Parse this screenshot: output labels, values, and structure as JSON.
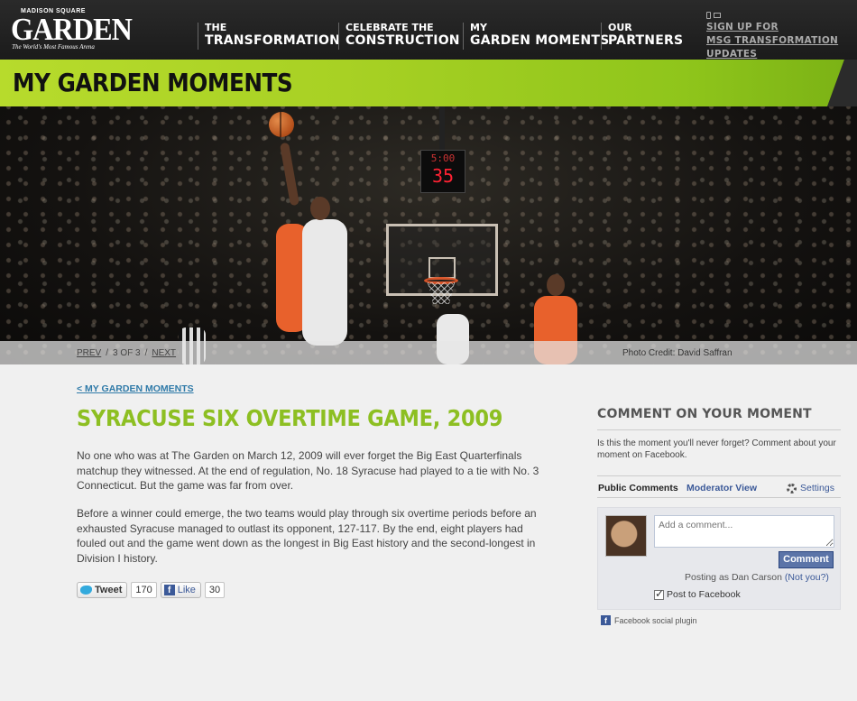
{
  "brand": {
    "logo_top": "MADISON SQUARE",
    "logo_main": "GARDEN",
    "logo_tagline": "The World's Most Famous Arena"
  },
  "nav": [
    {
      "line1": "THE",
      "line2": "TRANSFORMATION"
    },
    {
      "line1": "CELEBRATE THE",
      "line2": "CONSTRUCTION"
    },
    {
      "line1": "MY",
      "line2": "GARDEN MOMENTS"
    },
    {
      "line1": "OUR",
      "line2": "PARTNERS"
    }
  ],
  "signup": {
    "line1": "SIGN UP FOR",
    "line2": "MSG TRANSFORMATION UPDATES"
  },
  "banner": {
    "title": "MY GARDEN MOMENTS"
  },
  "hero": {
    "shot_clock_time": "5:00",
    "shot_clock_seconds": "35",
    "prev": "PREV",
    "position": "3 OF 3",
    "next": "NEXT",
    "separator": "/",
    "credit": "Photo Credit: David Saffran"
  },
  "article": {
    "back_link": "< MY GARDEN MOMENTS",
    "title": "SYRACUSE SIX OVERTIME GAME, 2009",
    "paragraph1": "No one who was at The Garden on March 12, 2009 will ever forget the Big East Quarterfinals matchup they witnessed. At the end of regulation, No. 18 Syracuse had played to a tie with No. 3 Connecticut. But the game was far from over.",
    "paragraph2": "Before a winner could emerge, the two teams would play through six overtime periods before an exhausted Syracuse managed to outlast its opponent, 127-117. By the end, eight players had fouled out and the game went down as the longest in Big East history and the second-longest in Division I history."
  },
  "social": {
    "tweet_label": "Tweet",
    "tweet_count": "170",
    "like_label": "Like",
    "like_count": "30"
  },
  "sidebar": {
    "heading": "COMMENT ON YOUR MOMENT",
    "intro": "Is this the moment you'll never forget? Comment about your moment on Facebook."
  },
  "fb": {
    "tab_public": "Public Comments",
    "tab_moderator": "Moderator View",
    "settings": "Settings",
    "comment_placeholder": "Add a comment...",
    "comment_button": "Comment",
    "posting_as": "Posting as Dan Carson",
    "not_you": "(Not you?)",
    "post_to_fb": "Post to Facebook",
    "plugin_label": "Facebook social plugin"
  },
  "colors": {
    "accent_green": "#8dbf22",
    "facebook_blue": "#3b5998",
    "link_blue": "#2f7aa8"
  }
}
